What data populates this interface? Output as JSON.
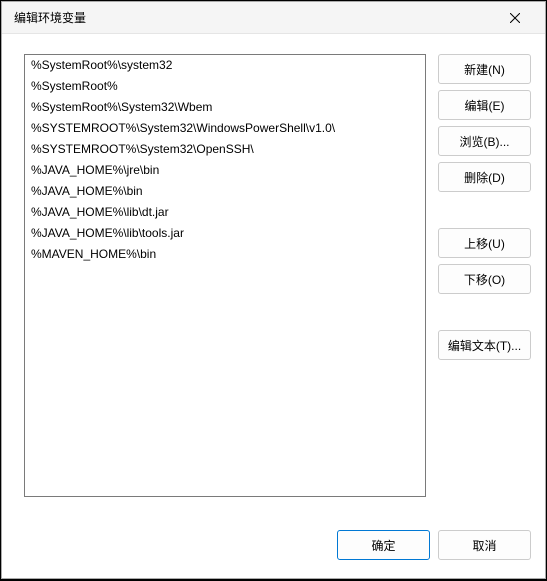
{
  "dialog": {
    "title": "编辑环境变量"
  },
  "paths": [
    "%SystemRoot%\\system32",
    "%SystemRoot%",
    "%SystemRoot%\\System32\\Wbem",
    "%SYSTEMROOT%\\System32\\WindowsPowerShell\\v1.0\\",
    "%SYSTEMROOT%\\System32\\OpenSSH\\",
    "%JAVA_HOME%\\jre\\bin",
    "%JAVA_HOME%\\bin",
    "%JAVA_HOME%\\lib\\dt.jar",
    "%JAVA_HOME%\\lib\\tools.jar",
    "%MAVEN_HOME%\\bin"
  ],
  "buttons": {
    "new_": "新建(N)",
    "edit": "编辑(E)",
    "browse": "浏览(B)...",
    "delete": "删除(D)",
    "moveup": "上移(U)",
    "movedown": "下移(O)",
    "edittext": "编辑文本(T)...",
    "ok": "确定",
    "cancel": "取消"
  }
}
